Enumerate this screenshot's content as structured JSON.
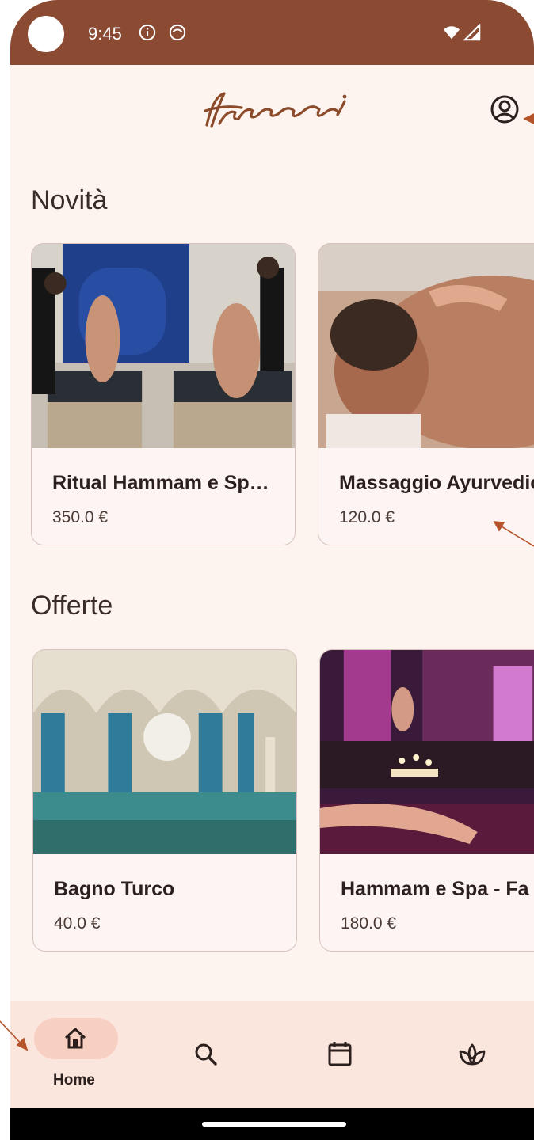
{
  "status_bar": {
    "time": "9:45"
  },
  "app_bar": {
    "logo_text": "Hammani"
  },
  "sections": [
    {
      "title": "Novità",
      "cards": [
        {
          "name": "Ritual Hammam e Sp…",
          "price": "350.0 €"
        },
        {
          "name": "Massaggio Ayurvedico",
          "price": "120.0 €"
        }
      ]
    },
    {
      "title": "Offerte",
      "cards": [
        {
          "name": "Bagno Turco",
          "price": "40.0 €"
        },
        {
          "name": "Hammam e Spa - Fa",
          "price": "180.0 €"
        }
      ]
    }
  ],
  "bottom_nav": {
    "items": [
      {
        "icon": "home-icon",
        "label": "Home",
        "selected": true
      },
      {
        "icon": "search-icon",
        "label": ""
      },
      {
        "icon": "calendar-icon",
        "label": ""
      },
      {
        "icon": "lotus-icon",
        "label": ""
      }
    ]
  },
  "colors": {
    "brand": "#8b4b33",
    "background": "#fdf4f0",
    "nav_background": "#fbe6de",
    "nav_pill": "#f8d0c2",
    "arrow": "#b5532a"
  }
}
